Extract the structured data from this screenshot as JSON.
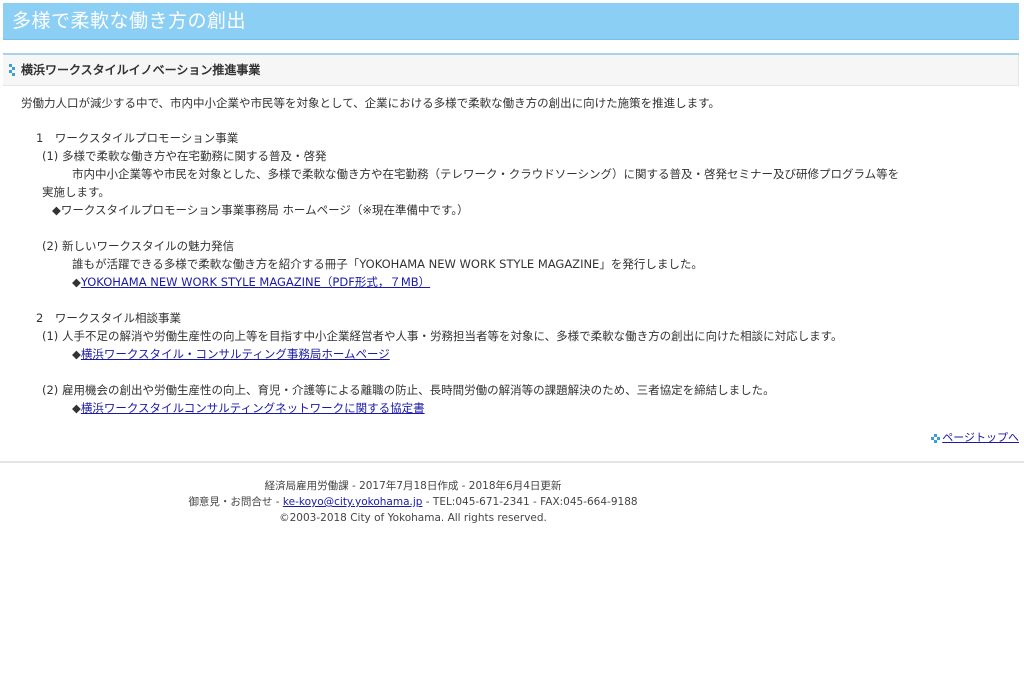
{
  "page_title": "多様で柔軟な働き方の創出",
  "section": {
    "heading": "横浜ワークスタイルイノベーション推進事業",
    "intro": "労働力人口が減少する中で、市内中小企業や市民等を対象として、企業における多様で柔軟な働き方の創出に向けた施策を推進します。",
    "items": [
      {
        "title": "1　ワークスタイルプロモーション事業",
        "subitems": [
          {
            "title": "(1) 多様で柔軟な働き方や在宅勤務に関する普及・啓発",
            "body_line1": "市内中小企業等や市民を対象とした、多様で柔軟な働き方や在宅勤務（テレワーク・クラウドソーシング）に関する普及・啓発セミナー及び研修プログラム等を",
            "body_line2": "実施します。",
            "link_marker": "◆",
            "link_text": "ワークスタイルプロモーション事業事務局 ホームページ（※現在準備中です。）"
          },
          {
            "title": "(2) 新しいワークスタイルの魅力発信",
            "body_line1": "誰もが活躍できる多様で柔軟な働き方を紹介する冊子「YOKOHAMA NEW WORK STYLE MAGAZINE」を発行しました。",
            "link_marker": "◆",
            "link_text": "YOKOHAMA NEW WORK STYLE MAGAZINE（PDF形式，７MB）"
          }
        ]
      },
      {
        "title": "2　ワークスタイル相談事業",
        "subitems": [
          {
            "title": "(1) 人手不足の解消や労働生産性の向上等を目指す中小企業経営者や人事・労務担当者等を対象に、多様で柔軟な働き方の創出に向けた相談に対応します。",
            "link_marker": "◆",
            "link_text": "横浜ワークスタイル・コンサルティング事務局ホームページ"
          },
          {
            "title": "(2) 雇用機会の創出や労働生産性の向上、育児・介護等による離職の防止、長時間労働の解消等の課題解決のため、三者協定を締結しました。",
            "link_marker": "◆",
            "link_text": "横浜ワークスタイルコンサルティングネットワークに関する協定書"
          }
        ]
      }
    ],
    "page_top_label": "ページトップへ"
  },
  "footer": {
    "line1": "経済局雇用労働課 - 2017年7月18日作成 - 2018年6月4日更新",
    "contact_prefix": "御意見・お問合せ - ",
    "email": "ke-koyo@city.yokohama.jp",
    "contact_suffix": " - TEL:045-671-2341 - FAX:045-664-9188",
    "copyright": "©2003-2018 City of Yokohama. All rights reserved."
  },
  "colors": {
    "title_bar": "#8ccff4",
    "link": "#1a1aa8",
    "accent": "#3d9fd8"
  },
  "icons": {
    "section_header": "dot-pattern-icon",
    "page_top": "dot-pattern-icon"
  }
}
